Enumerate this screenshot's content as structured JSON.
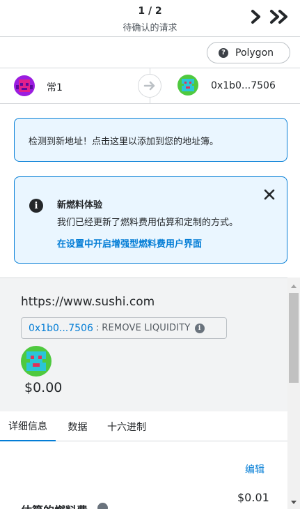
{
  "header": {
    "count": "1 / 2",
    "subtitle": "待确认的请求"
  },
  "network": {
    "label": "Polygon"
  },
  "accounts": {
    "from_name": "常1",
    "to_address": "0x1b0...7506"
  },
  "banners": {
    "new_address": "检测到新地址！点击这里以添加到您的地址簿。",
    "gas_title": "新燃料体验",
    "gas_desc": "我们已经更新了燃料费用估算和定制的方式。",
    "gas_link": "在设置中开启增强型燃料费用户界面"
  },
  "transaction": {
    "origin": "https://www.sushi.com",
    "contract": "0x1b0...7506",
    "separator": ":",
    "method": "REMOVE LIQUIDITY",
    "amount": "$0.00"
  },
  "tabs": [
    {
      "label": "详细信息"
    },
    {
      "label": "数据"
    },
    {
      "label": "十六进制"
    }
  ],
  "details": {
    "edit_label": "编辑",
    "fee_value": "$0.01",
    "fee_label": "估算的燃料费"
  },
  "colors": {
    "accent": "#037dd6",
    "banner_bg": "#eaf6ff"
  },
  "icons": {
    "next": "chevron-right-icon",
    "last": "double-chevron-right-icon",
    "network": "question-icon",
    "arrow": "arrow-right-icon",
    "info": "info-icon",
    "close": "close-icon"
  }
}
